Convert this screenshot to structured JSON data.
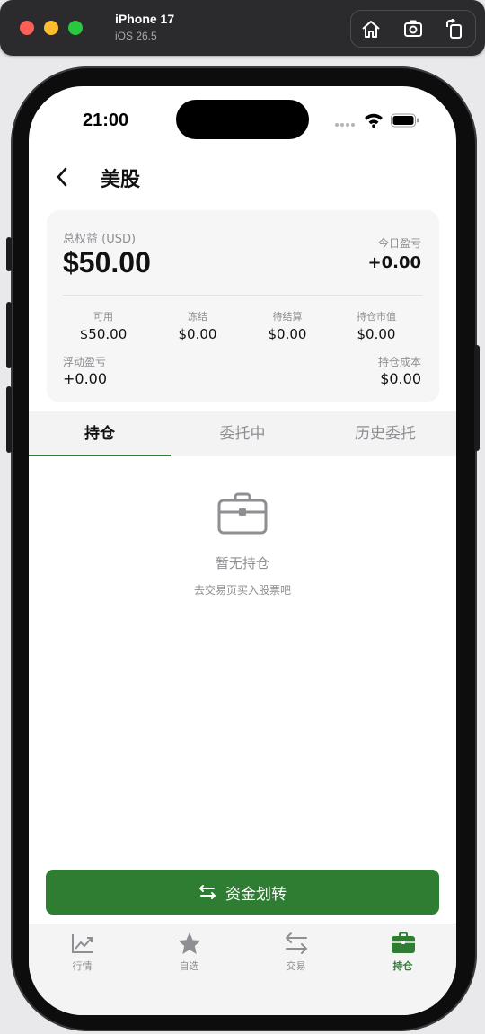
{
  "simulator": {
    "device": "iPhone 17",
    "os": "iOS 26.5"
  },
  "status_bar": {
    "time": "21:00"
  },
  "nav": {
    "title": "美股"
  },
  "summary": {
    "equity_label": "总权益 (USD)",
    "equity_value": "$50.00",
    "today_pnl_label": "今日盈亏",
    "today_pnl_value": "+0.00",
    "columns": [
      {
        "label": "可用",
        "value": "$50.00"
      },
      {
        "label": "冻结",
        "value": "$0.00"
      },
      {
        "label": "待结算",
        "value": "$0.00"
      },
      {
        "label": "持仓市值",
        "value": "$0.00"
      }
    ],
    "floating_pnl_label": "浮动盈亏",
    "floating_pnl_value": "+0.00",
    "position_cost_label": "持仓成本",
    "position_cost_value": "$0.00"
  },
  "tabs": [
    {
      "label": "持仓",
      "active": true
    },
    {
      "label": "委托中",
      "active": false
    },
    {
      "label": "历史委托",
      "active": false
    }
  ],
  "empty_state": {
    "icon": "briefcase-icon",
    "title": "暂无持仓",
    "subtitle": "去交易页买入股票吧"
  },
  "transfer_button": {
    "icon": "transfer-arrows-icon",
    "label": "资金划转"
  },
  "tab_bar": [
    {
      "label": "行情",
      "icon": "chart-line-icon",
      "active": false
    },
    {
      "label": "自选",
      "icon": "star-icon",
      "active": false
    },
    {
      "label": "交易",
      "icon": "swap-arrows-icon",
      "active": false
    },
    {
      "label": "持仓",
      "icon": "briefcase-icon",
      "active": true
    }
  ],
  "colors": {
    "accent": "#2e7d32",
    "muted_text": "#8e8e93"
  }
}
